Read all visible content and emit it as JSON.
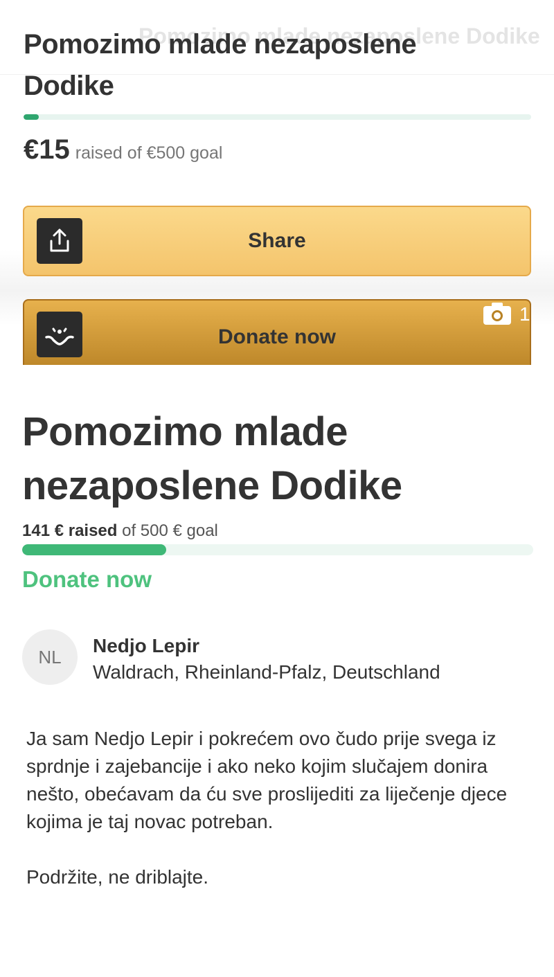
{
  "top_screenshot": {
    "ghost_title": "Pomozimo mlade nezaposlene Dodike",
    "title": "Pomozimo mlade nezaposlene Dodike",
    "progress_percent": 3,
    "amount": "€15",
    "goal_text": "raised of €500 goal",
    "share_button": "Share",
    "donate_button": "Donate now",
    "camera_count": "1",
    "icons": [
      "share-upload-icon",
      "donate-hands-icon",
      "camera-icon"
    ]
  },
  "bottom_screenshot": {
    "title": "Pomozimo mlade nezaposlene Dodike",
    "raised_strong": "141 € raised",
    "raised_rest": " of 500 € goal",
    "progress_percent": 28.2,
    "donate_link": "Donate now",
    "organizer": {
      "initials": "NL",
      "name": "Nedjo Lepir",
      "location": "Waldrach, Rheinland-Pfalz, Deutschland"
    },
    "story": [
      "Ja sam Nedjo Lepir i pokrećem ovo čudo prije svega iz sprdnje i zajebancije i ako neko kojim slučajem donira nešto, obećavam da ću sve proslijediti za liječenje djece kojima je taj novac potreban.",
      "Podržite, ne driblajte."
    ]
  },
  "colors": {
    "progress_green": "#3fb877",
    "share_button_bg": "#f4c46c",
    "donate_button_bg": "#b88225",
    "donate_link_green": "#4ec27e"
  }
}
